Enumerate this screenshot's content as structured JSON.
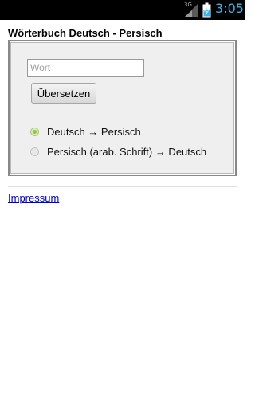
{
  "status_bar": {
    "network_label": "3G",
    "clock": "3:05",
    "icons": {
      "signal": "signal-icon",
      "battery": "battery-charging-icon"
    },
    "accent_color": "#33b5e5"
  },
  "header": {
    "title": "Wörterbuch Deutsch - Persisch"
  },
  "form": {
    "word_input": {
      "value": "",
      "placeholder": "Wort"
    },
    "translate_button_label": "Übersetzen",
    "directions": [
      {
        "label": "Deutsch → Persisch",
        "checked": true
      },
      {
        "label": "Persisch (arab. Schrift) → Deutsch",
        "checked": false
      }
    ],
    "radio_checked_color": "#8dc63f"
  },
  "footer": {
    "impressum_label": "Impressum",
    "link_color": "#0000cc"
  }
}
